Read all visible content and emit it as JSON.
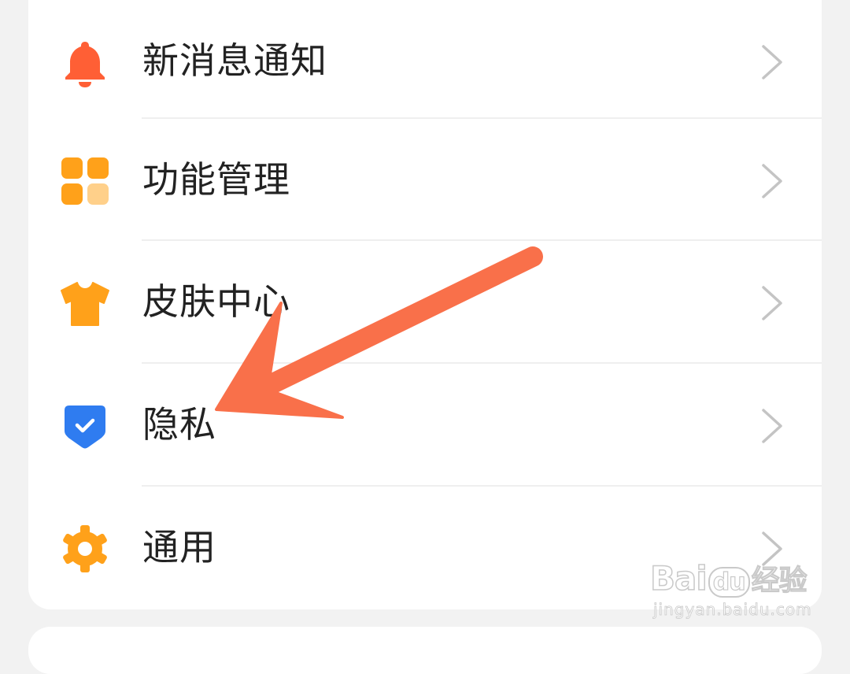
{
  "settings": {
    "items": [
      {
        "label": "新消息通知",
        "icon": "bell-icon",
        "color": "#ff5f35"
      },
      {
        "label": "功能管理",
        "icon": "grid-icon",
        "color": "#ffa11a"
      },
      {
        "label": "皮肤中心",
        "icon": "tshirt-icon",
        "color": "#ffa11a"
      },
      {
        "label": "隐私",
        "icon": "shield-check-icon",
        "color": "#2f7cf0"
      },
      {
        "label": "通用",
        "icon": "gear-icon",
        "color": "#ffa11a"
      }
    ]
  },
  "annotation": {
    "arrow_color": "#f9704a",
    "points_to": "隐私"
  },
  "watermark": {
    "brand_a": "Bai",
    "brand_b": "du",
    "brand_c": "经验",
    "url": "jingyan.baidu.com"
  }
}
